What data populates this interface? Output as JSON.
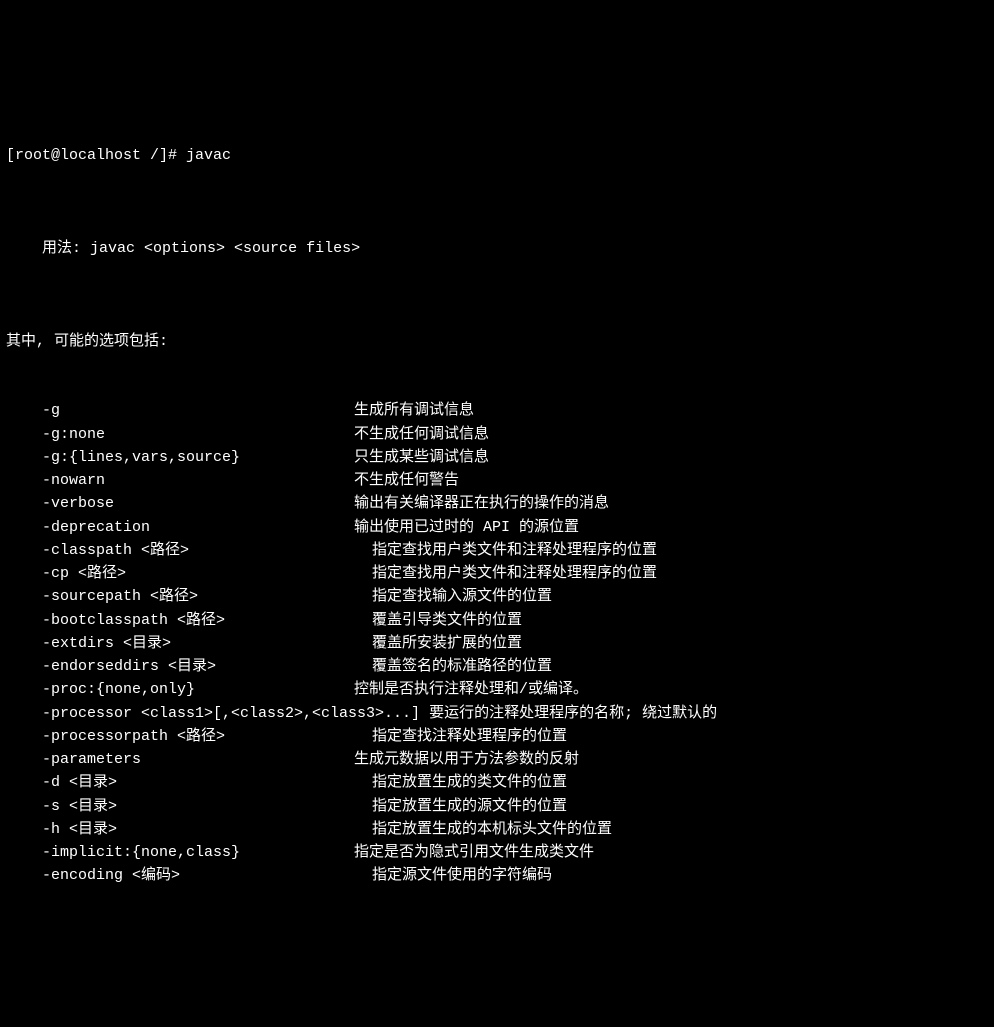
{
  "prompt": "[root@localhost /]# ",
  "command": "javac",
  "usage_label": "用法: ",
  "usage_text": "javac <options> <source files>",
  "options_header": "其中, 可能的选项包括:",
  "options": [
    {
      "flag": "-g",
      "desc": "生成所有调试信息",
      "desc_indent": 0
    },
    {
      "flag": "-g:none",
      "desc": "不生成任何调试信息",
      "desc_indent": 0
    },
    {
      "flag": "-g:{lines,vars,source}",
      "desc": "只生成某些调试信息",
      "desc_indent": 0
    },
    {
      "flag": "-nowarn",
      "desc": "不生成任何警告",
      "desc_indent": 0
    },
    {
      "flag": "-verbose",
      "desc": "输出有关编译器正在执行的操作的消息",
      "desc_indent": 0
    },
    {
      "flag": "-deprecation",
      "desc": "输出使用已过时的 API 的源位置",
      "desc_indent": 0
    },
    {
      "flag": "-classpath <路径>",
      "desc": "  指定查找用户类文件和注释处理程序的位置",
      "desc_indent": 1
    },
    {
      "flag": "-cp <路径>",
      "desc": "  指定查找用户类文件和注释处理程序的位置",
      "desc_indent": 1
    },
    {
      "flag": "-sourcepath <路径>",
      "desc": "  指定查找输入源文件的位置",
      "desc_indent": 1
    },
    {
      "flag": "-bootclasspath <路径>",
      "desc": "  覆盖引导类文件的位置",
      "desc_indent": 1
    },
    {
      "flag": "-extdirs <目录>",
      "desc": "  覆盖所安装扩展的位置",
      "desc_indent": 1
    },
    {
      "flag": "-endorseddirs <目录>",
      "desc": "  覆盖签名的标准路径的位置",
      "desc_indent": 1
    },
    {
      "flag": "-proc:{none,only}",
      "desc": "控制是否执行注释处理和/或编译。",
      "desc_indent": 0
    },
    {
      "flag": "-processor <class1>[,<class2>,<class3>...] 要运行的注释处理程序的名称; 绕过默认的",
      "desc": "",
      "desc_indent": 0,
      "single": true
    },
    {
      "flag": "-processorpath <路径>",
      "desc": "  指定查找注释处理程序的位置",
      "desc_indent": 1
    },
    {
      "flag": "-parameters",
      "desc": "生成元数据以用于方法参数的反射",
      "desc_indent": 0
    },
    {
      "flag": "-d <目录>",
      "desc": "  指定放置生成的类文件的位置",
      "desc_indent": 1
    },
    {
      "flag": "-s <目录>",
      "desc": "  指定放置生成的源文件的位置",
      "desc_indent": 1
    },
    {
      "flag": "-h <目录>",
      "desc": "  指定放置生成的本机标头文件的位置",
      "desc_indent": 1
    },
    {
      "flag": "-implicit:{none,class}",
      "desc": "指定是否为隐式引用文件生成类文件",
      "desc_indent": 0
    },
    {
      "flag": "-encoding <编码>",
      "desc": "  指定源文件使用的字符编码",
      "desc_indent": 1
    }
  ]
}
